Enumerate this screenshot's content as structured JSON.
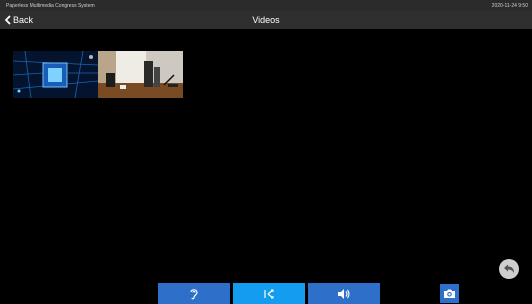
{
  "statusbar": {
    "app_name": "Paperless Multimedia Congress System",
    "clock": "2020-11-24 9:50"
  },
  "header": {
    "back_label": "Back",
    "title": "Videos"
  },
  "videos": [
    {
      "icon": "chip-thumbnail"
    },
    {
      "icon": "room-thumbnail"
    }
  ],
  "toolbar": {
    "buttons": [
      {
        "icon": "ear-icon",
        "active": false
      },
      {
        "icon": "split-arrows-icon",
        "active": true
      },
      {
        "icon": "speaker-icon",
        "active": false
      }
    ],
    "camera_icon": "camera-icon",
    "undo_icon": "undo-icon"
  },
  "colors": {
    "accent": "#2d6fc9",
    "active": "#149df0",
    "background": "#000000"
  }
}
